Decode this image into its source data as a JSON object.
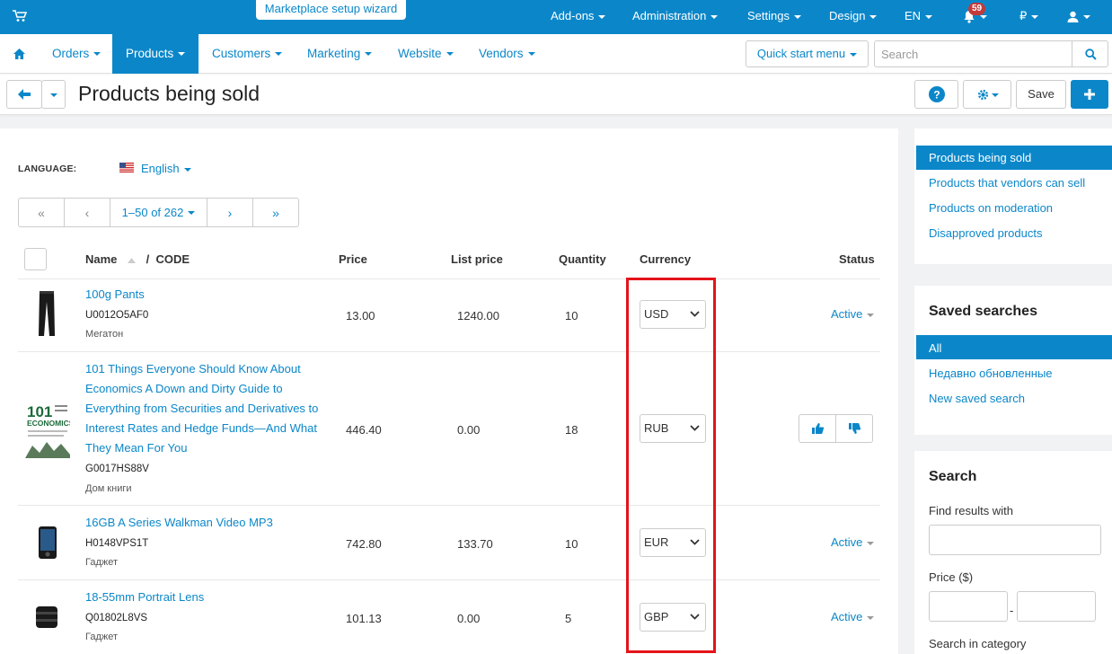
{
  "topbar": {
    "wizard": "Marketplace setup wizard",
    "items": [
      "Add-ons",
      "Administration",
      "Settings",
      "Design",
      "EN"
    ],
    "notifications": "59",
    "currency": "₽"
  },
  "mainnav": {
    "items": [
      "Orders",
      "Products",
      "Customers",
      "Marketing",
      "Website",
      "Vendors"
    ],
    "quick_start": "Quick start menu",
    "search_placeholder": "Search"
  },
  "titlebar": {
    "title": "Products being sold",
    "save": "Save"
  },
  "filters": {
    "language_label": "LANGUAGE:",
    "language": "English",
    "pagination": "1–50 of 262"
  },
  "table": {
    "headers": {
      "name": "Name",
      "separator": "/",
      "code": "CODE",
      "price": "Price",
      "list_price": "List price",
      "quantity": "Quantity",
      "currency": "Currency",
      "status": "Status"
    },
    "rows": [
      {
        "name": "100g Pants",
        "code": "U0012O5AF0",
        "vendor": "Мегатон",
        "price": "13.00",
        "list_price": "1240.00",
        "quantity": "10",
        "currency": "USD",
        "status": "Active"
      },
      {
        "name_lines": [
          "101 Things Everyone Should Know About",
          "Economics A Down and Dirty Guide to",
          "Everything from Securities and Derivatives to",
          "Interest Rates and Hedge Funds—And What",
          "They Mean For You"
        ],
        "code": "G0017HS88V",
        "vendor": "Дом книги",
        "price": "446.40",
        "list_price": "0.00",
        "quantity": "18",
        "currency": "RUB",
        "status": ""
      },
      {
        "name": "16GB A Series Walkman Video MP3",
        "code": "H0148VPS1T",
        "vendor": "Гаджет",
        "price": "742.80",
        "list_price": "133.70",
        "quantity": "10",
        "currency": "EUR",
        "status": "Active"
      },
      {
        "name": "18-55mm Portrait Lens",
        "code": "Q01802L8VS",
        "vendor": "Гаджет",
        "price": "101.13",
        "list_price": "0.00",
        "quantity": "5",
        "currency": "GBP",
        "status": "Active"
      }
    ]
  },
  "sidebar": {
    "views": [
      "Products being sold",
      "Products that vendors can sell",
      "Products on moderation",
      "Disapproved products"
    ],
    "saved_title": "Saved searches",
    "saved": [
      "All",
      "Недавно обновленные",
      "New saved search"
    ],
    "search_title": "Search",
    "find_label": "Find results with",
    "price_label": "Price ($)",
    "price_dash": "-",
    "category_label": "Search in category"
  },
  "colors": {
    "brand": "#0b87c9",
    "highlight": "#e5131a"
  }
}
